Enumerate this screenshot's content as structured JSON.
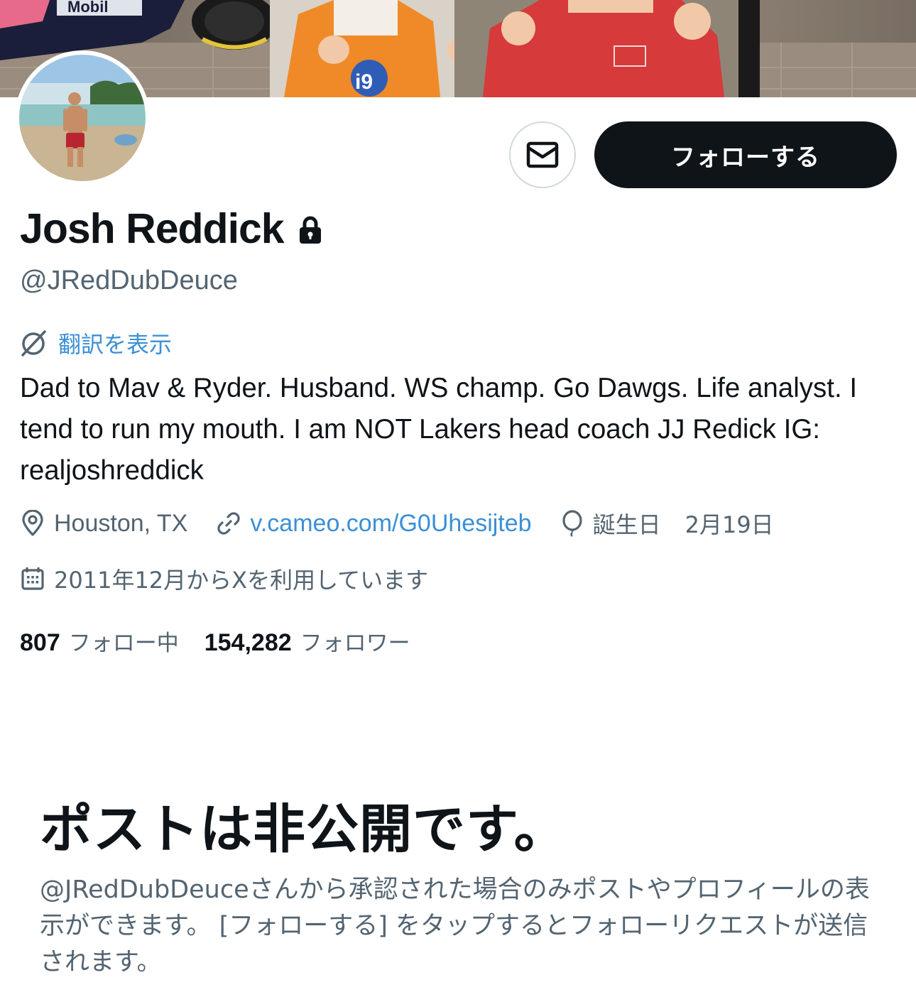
{
  "profile": {
    "name": "Josh Reddick",
    "handle": "@JRedDubDeuce",
    "translate_label": "翻訳を表示",
    "bio": "Dad to Mav & Ryder. Husband. WS champ. Go Dawgs. Life analyst. I tend to run my mouth. I am NOT Lakers head coach JJ Redick IG: realjoshreddick",
    "location": "Houston, TX",
    "website": "v.cameo.com/G0Uhesijteb",
    "birthday_label": "誕生日",
    "birthday": "2月19日",
    "joined": "2011年12月からXを利用しています",
    "protected": true
  },
  "actions": {
    "follow_label": "フォローする",
    "message_icon": "envelope-icon"
  },
  "stats": {
    "following_count": "807",
    "following_label": "フォロー中",
    "followers_count": "154,282",
    "followers_label": "フォロワー"
  },
  "private_notice": {
    "title": "ポストは非公開です。",
    "description": "@JRedDubDeuceさんから承認された場合のみポストやプロフィールの表示ができます。 [フォローする] をタップするとフォローリクエストが送信されます。"
  },
  "banner_text": "Mobil",
  "colors": {
    "text_primary": "#0f1419",
    "text_secondary": "#536471",
    "link": "#3b8fd6",
    "follow_button_bg": "#0f1419",
    "border": "#cfd9de"
  }
}
